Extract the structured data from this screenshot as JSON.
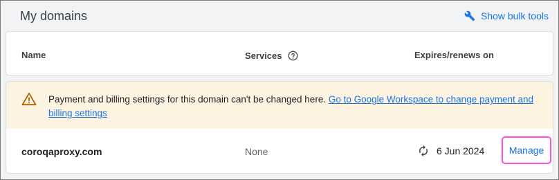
{
  "page": {
    "title": "My domains",
    "bulk_tools_label": "Show bulk tools",
    "bulk_tools_icon": "wrench-icon"
  },
  "table": {
    "columns": {
      "name": "Name",
      "services": "Services",
      "expires": "Expires/renews on"
    },
    "services_help_icon": "help-circle-icon"
  },
  "banner": {
    "icon": "warning-icon",
    "text": "Payment and billing settings for this domain can't be changed here. ",
    "link": "Go to Google Workspace to change payment and billing settings",
    "background": "#fdf3e1"
  },
  "domains": [
    {
      "name": "coroqaproxy.com",
      "services": "None",
      "renew_icon": "autorenew-icon",
      "expires": "6 Jun 2024",
      "action": "Manage"
    }
  ],
  "colors": {
    "accent": "#1a73e8",
    "highlight_outline": "#ff4fd8",
    "warning": "#b06000"
  }
}
